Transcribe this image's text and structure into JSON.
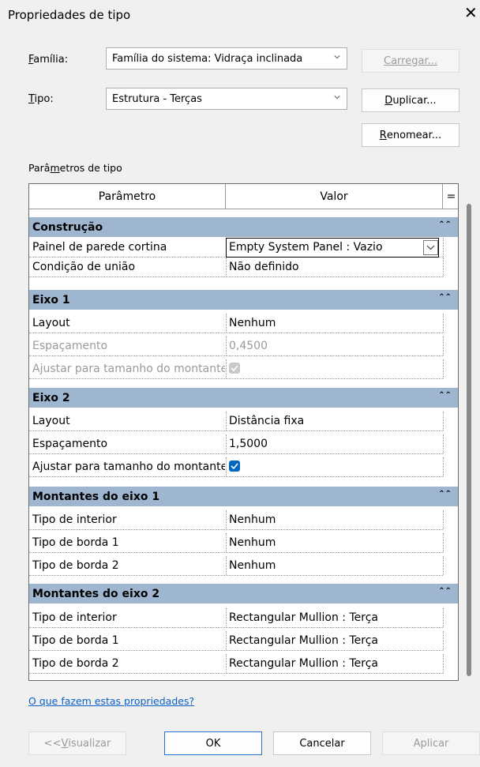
{
  "window": {
    "title": "Propriedades de tipo"
  },
  "familia": {
    "label_u": "F",
    "label_rest": "amília:",
    "value": "Família do sistema: Vidraça inclinada"
  },
  "tipo": {
    "label_u": "T",
    "label_rest": "ipo:",
    "value": "Estrutura - Terças"
  },
  "buttons": {
    "carregar": "Carregar...",
    "duplicar_u": "D",
    "duplicar_rest": "uplicar...",
    "renomear_u": "R",
    "renomear_rest": "enomear...",
    "visualizar_pre": "<< ",
    "visualizar_u": "V",
    "visualizar_rest": "isualizar",
    "ok": "OK",
    "cancelar": "Cancelar",
    "aplicar": "Aplicar"
  },
  "section_label": {
    "pre": "Parâ",
    "u": "m",
    "rest": "etros de tipo"
  },
  "table": {
    "headers": {
      "param": "Parâmetro",
      "value": "Valor",
      "eq": "="
    },
    "groups": [
      {
        "name": "Construção",
        "rows": [
          {
            "param": "Painel de parede cortina",
            "value": "Empty System Panel : Vazio"
          },
          {
            "param": "Condição de união",
            "value": "Não definido"
          }
        ]
      },
      {
        "name": "Eixo 1",
        "rows": [
          {
            "param": "Layout",
            "value": "Nenhum"
          },
          {
            "param": "Espaçamento",
            "value": "0,4500"
          },
          {
            "param": "Ajustar para tamanho do montante",
            "value": ""
          }
        ]
      },
      {
        "name": "Eixo 2",
        "rows": [
          {
            "param": "Layout",
            "value": "Distância fixa"
          },
          {
            "param": "Espaçamento",
            "value": "1,5000"
          },
          {
            "param": "Ajustar para tamanho do montante",
            "value": ""
          }
        ]
      },
      {
        "name": "Montantes do eixo 1",
        "rows": [
          {
            "param": "Tipo de interior",
            "value": "Nenhum"
          },
          {
            "param": "Tipo de borda 1",
            "value": "Nenhum"
          },
          {
            "param": "Tipo de borda 2",
            "value": "Nenhum"
          }
        ]
      },
      {
        "name": "Montantes do eixo 2",
        "rows": [
          {
            "param": "Tipo de interior",
            "value": "Rectangular Mullion : Terça"
          },
          {
            "param": "Tipo de borda 1",
            "value": "Rectangular Mullion : Terça"
          },
          {
            "param": "Tipo de borda 2",
            "value": "Rectangular Mullion : Terça"
          }
        ]
      }
    ]
  },
  "help_link": "O que fazem estas propriedades?",
  "colors": {
    "group_bg": "#9fb6d1",
    "accent": "#0067c0",
    "link": "#0b5fc4"
  }
}
